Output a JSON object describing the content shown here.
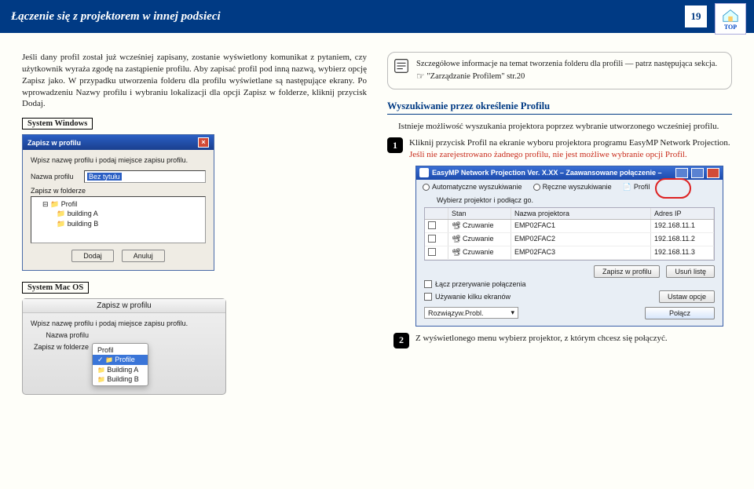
{
  "header": {
    "title": "Łączenie się z projektorem w innej podsieci",
    "page_number": "19",
    "logo_text": "TOP"
  },
  "left": {
    "p1": "Jeśli dany profil został już wcześniej zapisany, zostanie wyświetlony komunikat z pytaniem, czy użytkownik wyraża zgodę na zastąpienie profilu. Aby zapisać profil pod inną nazwą, wybierz opcję Zapisz jako. W przypadku utworzenia folderu dla profilu wyświetlane są następujące ekrany. Po wprowadzeniu Nazwy profilu i wybraniu lokalizacji dla opcji Zapisz w folderze, kliknij przycisk Dodaj.",
    "label_windows": "System Windows",
    "label_mac": "System Mac OS",
    "win": {
      "title": "Zapisz w profilu",
      "hint": "Wpisz nazwę profilu i podaj miejsce zapisu profilu.",
      "name_label": "Nazwa profilu",
      "name_value": "Bez tytułu",
      "folder_label": "Zapisz w folderze",
      "root": "Profil",
      "child_a": "building A",
      "child_b": "building B",
      "btn_add": "Dodaj",
      "btn_cancel": "Anuluj"
    },
    "mac": {
      "title": "Zapisz w profilu",
      "hint": "Wpisz nazwę profilu i podaj miejsce zapisu profilu.",
      "name_label": "Nazwa profilu",
      "folder_label": "Zapisz w folderze",
      "opt1": "Profil",
      "opt2": "Profile",
      "opt3": "Building A",
      "opt4": "Building B"
    }
  },
  "right": {
    "info1": "Szczegółowe informacje na temat tworzenia folderu dla profili — patrz następująca sekcja.",
    "info_link": "\"Zarządzanie Profilem\"  str.20",
    "section": "Wyszukiwanie przez określenie Profilu",
    "p1": "Istnieje możliwość wyszukania projektora poprzez wybranie utworzonego wcześniej profilu.",
    "step1_a": "Kliknij przycisk Profil na ekranie wyboru projektora programu EasyMP Network Projection.",
    "step1_b": "Jeśli nie zarejestrowano żadnego profilu, nie jest możliwe wybranie opcji Profil.",
    "step1_num": "1",
    "step2_num": "2",
    "step2": "Z wyświetlonego menu wybierz projektor, z którym chcesz się połączyć.",
    "app": {
      "title": "EasyMP Network Projection Ver. X.XX – Zaawansowane połączenie –",
      "tab1": "Automatyczne wyszukiwanie",
      "tab2": "Ręczne wyszukiwanie",
      "tab3": "Profil",
      "sub": "Wybierz projektor i podłącz go.",
      "col_stan": "Stan",
      "col_name": "Nazwa projektora",
      "col_ip": "Adres IP",
      "rows": [
        {
          "stan": "Czuwanie",
          "name": "EMP02FAC1",
          "ip": "192.168.11.1"
        },
        {
          "stan": "Czuwanie",
          "name": "EMP02FAC2",
          "ip": "192.168.11.2"
        },
        {
          "stan": "Czuwanie",
          "name": "EMP02FAC3",
          "ip": "192.168.11.3"
        }
      ],
      "btn_save": "Zapisz w profilu",
      "btn_clear": "Usuń listę",
      "chk1": "Łącz przerywanie połączenia",
      "chk2": "Używanie kilku ekranów",
      "btn_opt": "Ustaw opcje",
      "drop": "Rozwiązyw.Probl.",
      "btn_connect": "Połącz"
    }
  }
}
